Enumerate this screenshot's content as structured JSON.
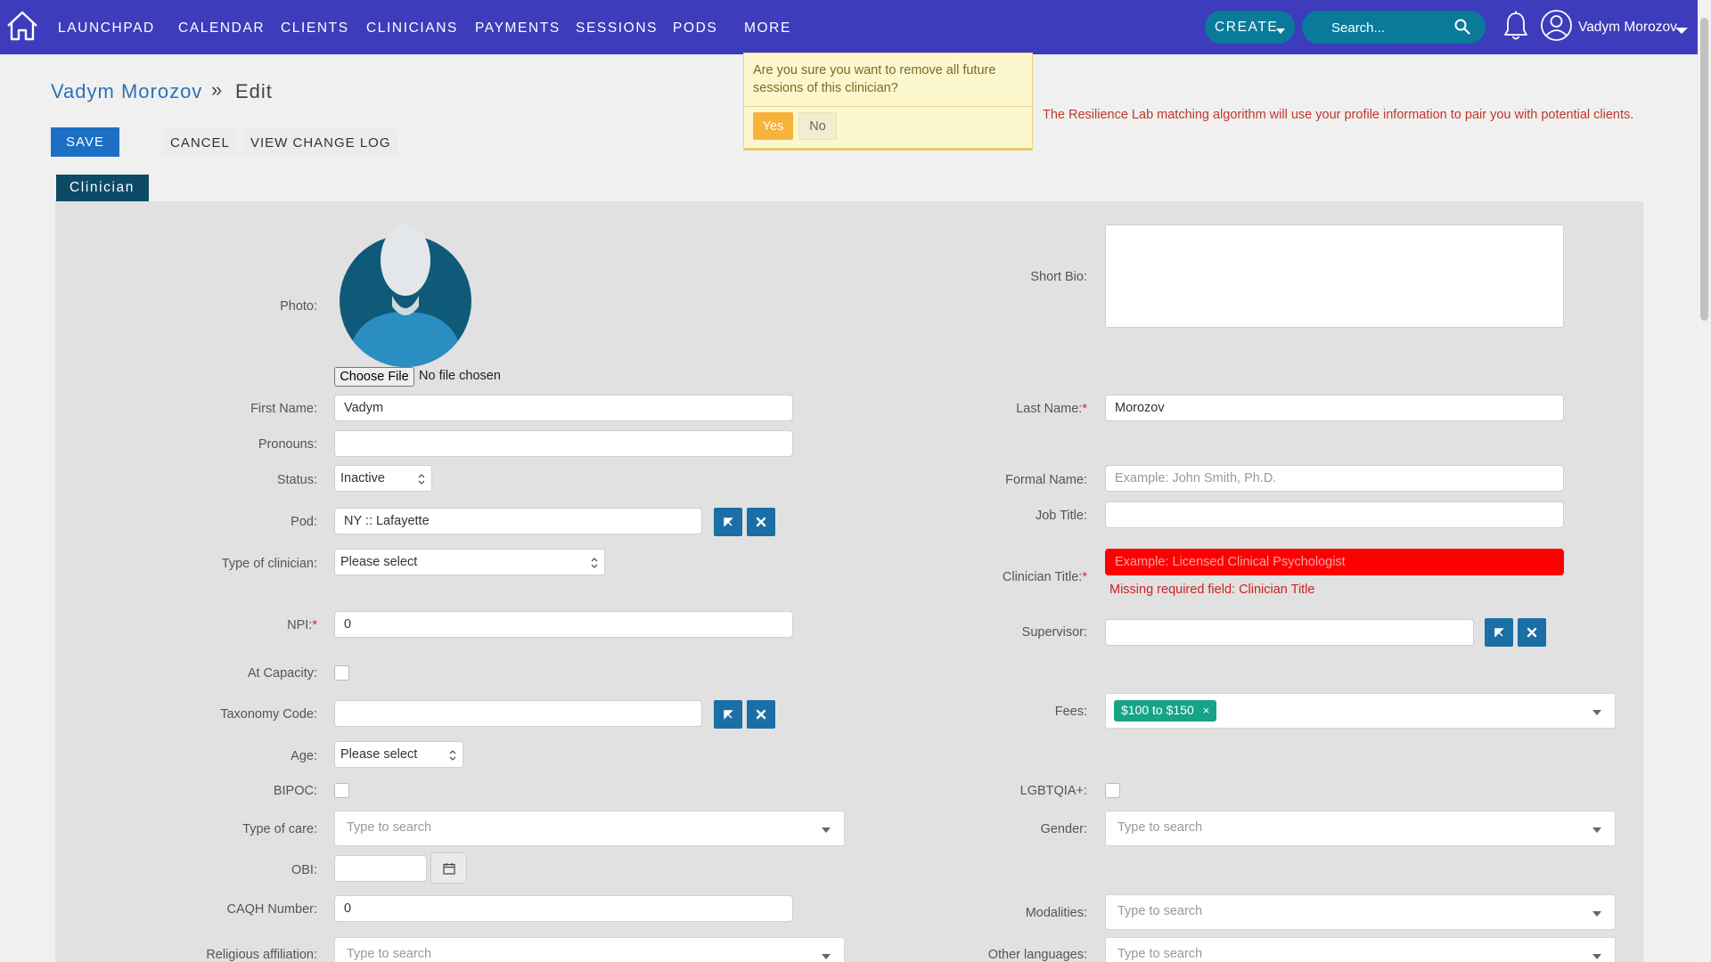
{
  "nav": {
    "items": [
      "LAUNCHPAD",
      "CALENDAR",
      "CLIENTS",
      "CLINICIANS",
      "PAYMENTS",
      "SESSIONS",
      "PODS",
      "MORE"
    ],
    "create_label": "CREATE",
    "search_placeholder": "Search...",
    "user_name": "Vadym Morozov",
    "bg_color": "#3c3cbc",
    "accent_color": "#0a7a9a"
  },
  "header": {
    "breadcrumb_name": "Vadym Morozov",
    "breadcrumb_separator": "»",
    "breadcrumb_current": "Edit",
    "save_label": "SAVE",
    "cancel_label": "CANCEL",
    "change_log_label": "VIEW CHANGE LOG"
  },
  "confirm": {
    "message": "Are you sure you want to remove all future sessions of this clinician?",
    "yes_label": "Yes",
    "no_label": "No"
  },
  "matching_note": "The Resilience Lab matching algorithm will use your profile information to pair you with potential clients.",
  "tab": {
    "label": "Clinician"
  },
  "form": {
    "photo_label": "Photo:",
    "choose_file_label": "Choose File",
    "no_file_label": "No file chosen",
    "short_bio_label": "Short Bio:",
    "first_name_label": "First Name:",
    "first_name_value": "Vadym",
    "last_name_label": "Last Name:",
    "last_name_value": "Morozov",
    "pronouns_label": "Pronouns:",
    "status_label": "Status:",
    "status_value": "Inactive",
    "formal_name_label": "Formal Name:",
    "formal_name_placeholder": "Example: John Smith, Ph.D.",
    "pod_label": "Pod:",
    "pod_value": "NY :: Lafayette",
    "job_title_label": "Job Title:",
    "type_of_clinician_label": "Type of clinician:",
    "type_of_clinician_value": "Please select",
    "clinician_title_label": "Clinician Title:",
    "clinician_title_placeholder": "Example: Licensed Clinical Psychologist",
    "clinician_title_error": "Missing required field: Clinician Title",
    "npi_label": "NPI:",
    "npi_value": "0",
    "supervisor_label": "Supervisor:",
    "at_capacity_label": "At Capacity:",
    "taxonomy_label": "Taxonomy Code:",
    "fees_label": "Fees:",
    "fees_tag": "$100 to $150",
    "fees_tag_remove": "×",
    "age_label": "Age:",
    "age_value": "Please select",
    "bipoc_label": "BIPOC:",
    "lgbtqia_label": "LGBTQIA+:",
    "type_of_care_label": "Type of care:",
    "gender_label": "Gender:",
    "obi_label": "OBI:",
    "caqh_label": "CAQH Number:",
    "caqh_value": "0",
    "modalities_label": "Modalities:",
    "religious_label": "Religious affiliation:",
    "other_languages_label": "Other languages:",
    "type_to_search": "Type to search",
    "required_mark": "*",
    "error_color": "#ff0000"
  }
}
